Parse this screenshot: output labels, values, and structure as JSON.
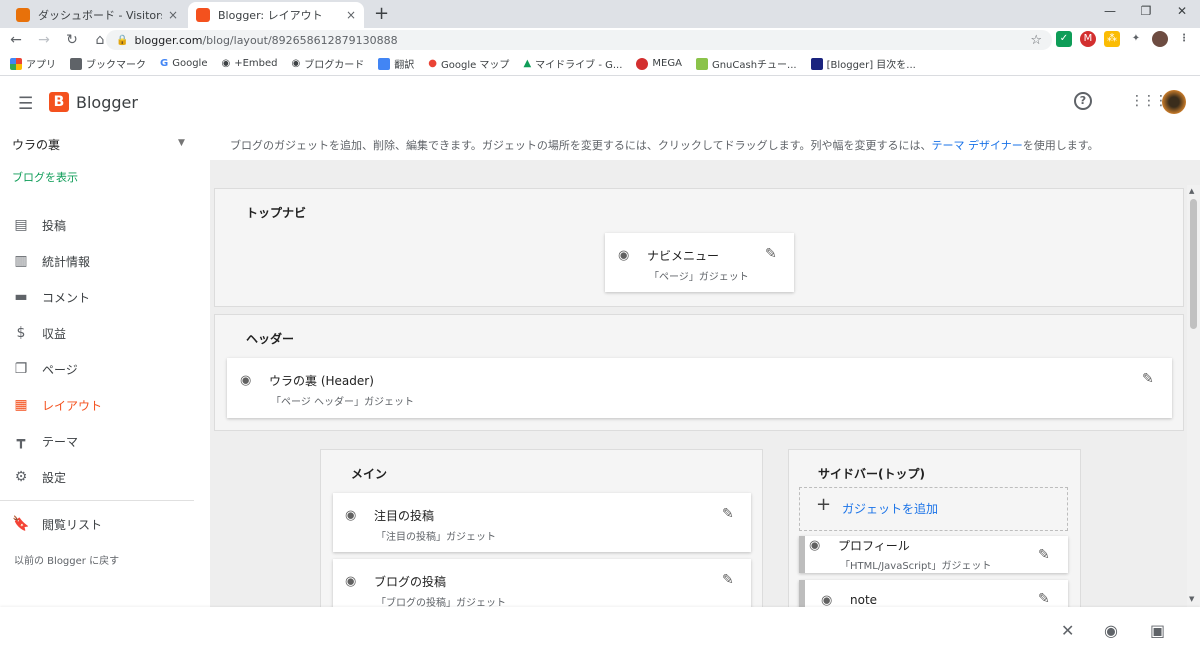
{
  "browser": {
    "tabs": [
      {
        "title": "ダッシュボード - Visitors - Vis",
        "close": "×"
      },
      {
        "title": "Blogger: レイアウト",
        "close": "×"
      }
    ],
    "new_tab": "+",
    "url_host": "blogger.com",
    "url_path": "/blog/layout/892658612879130888",
    "bookmarks": [
      "アプリ",
      "ブックマーク",
      "Google",
      "+Embed",
      "ブログカード",
      "翻訳",
      "Google マップ",
      "マイドライブ - G...",
      "MEGA",
      "GnuCashチュー...",
      "[Blogger] 目次を..."
    ]
  },
  "header": {
    "brand": "Blogger",
    "help_glyph": "?"
  },
  "sidebar": {
    "blog_name": "ウラの裏",
    "view_blog": "ブログを表示",
    "items": [
      {
        "label": "投稿",
        "icon": "posts-icon"
      },
      {
        "label": "統計情報",
        "icon": "stats-icon"
      },
      {
        "label": "コメント",
        "icon": "comments-icon"
      },
      {
        "label": "収益",
        "icon": "earnings-icon"
      },
      {
        "label": "ページ",
        "icon": "pages-icon"
      },
      {
        "label": "レイアウト",
        "icon": "layout-icon"
      },
      {
        "label": "テーマ",
        "icon": "theme-icon"
      },
      {
        "label": "設定",
        "icon": "settings-icon"
      },
      {
        "label": "閲覧リスト",
        "icon": "reading-list-icon"
      }
    ],
    "back_old": "以前の Blogger に戻す"
  },
  "main": {
    "intro_text": "ブログのガジェットを追加、削除、編集できます。ガジェットの場所を変更するには、クリックしてドラッグします。列や幅を変更するには、",
    "intro_link": "テーマ デザイナー",
    "intro_tail": "を使用します。",
    "sections": {
      "topnav": {
        "title": "トップナビ",
        "widget": {
          "name": "ナビメニュー",
          "sub": "「ページ」ガジェット"
        }
      },
      "header": {
        "title": "ヘッダー",
        "widget": {
          "name": "ウラの裏 (Header)",
          "sub": "「ページ ヘッダー」ガジェット"
        }
      },
      "main": {
        "title": "メイン",
        "widgets": [
          {
            "name": "注目の投稿",
            "sub": "「注目の投稿」ガジェット"
          },
          {
            "name": "ブログの投稿",
            "sub": "「ブログの投稿」ガジェット"
          }
        ]
      },
      "sidebar_top": {
        "title": "サイドバー(トップ)",
        "add_gadget": "ガジェットを追加",
        "widgets": [
          {
            "name": "プロフィール",
            "sub": "「HTML/JavaScript」ガジェット"
          },
          {
            "name": "note",
            "sub": ""
          }
        ]
      }
    }
  },
  "colors": {
    "accent": "#f4511e",
    "link": "#1a73e8",
    "view_blog": "#0f9d58"
  }
}
